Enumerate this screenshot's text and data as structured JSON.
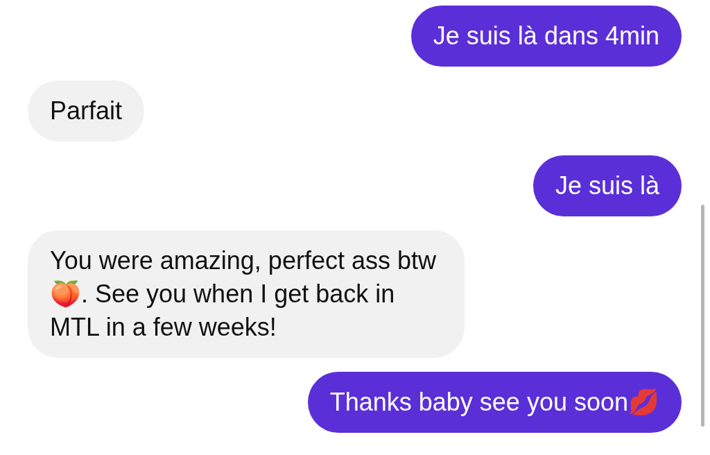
{
  "messages": [
    {
      "kind": "sent",
      "text": "Je suis là dans 4min"
    },
    {
      "kind": "received",
      "text": "Parfait"
    },
    {
      "kind": "sent",
      "text": "Je suis là"
    },
    {
      "kind": "received",
      "text": "You were amazing, perfect ass btw🍑. See you when I get back in MTL in a few weeks!"
    },
    {
      "kind": "sent",
      "text": "Thanks baby see you soon💋"
    }
  ]
}
